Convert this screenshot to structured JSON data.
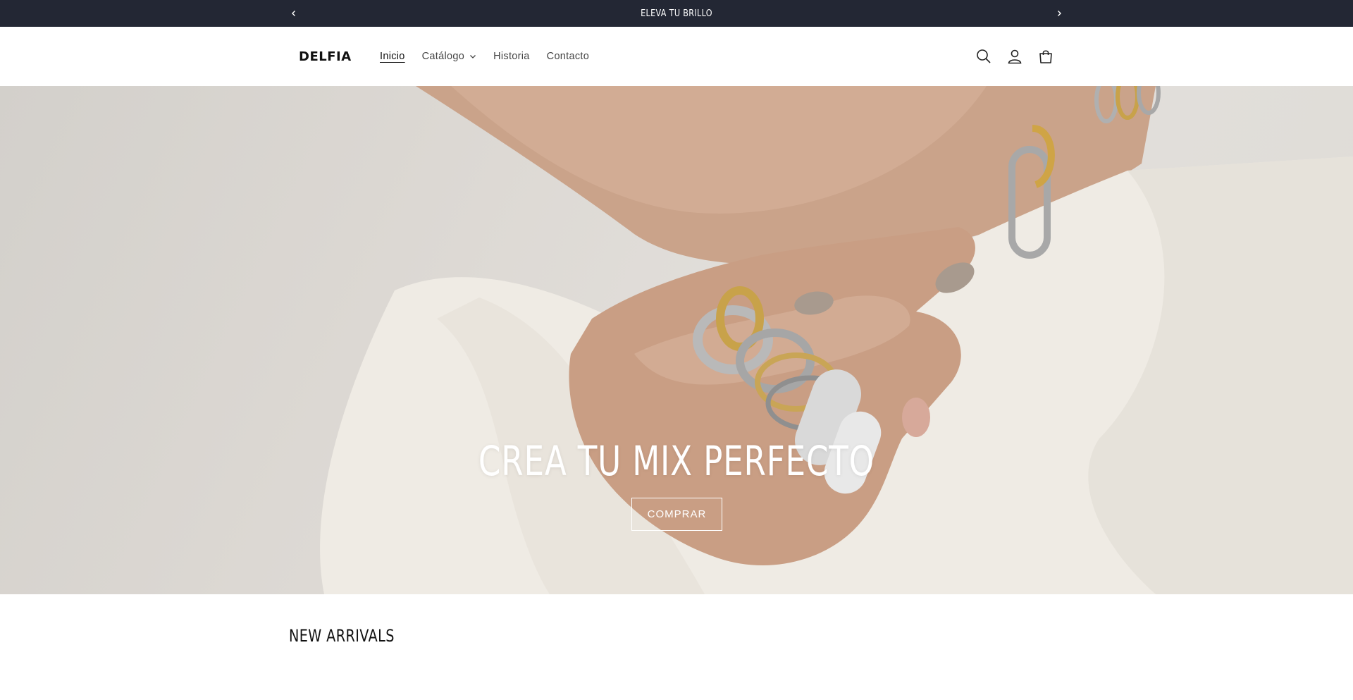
{
  "announcement": {
    "message": "ELEVA TU BRILLO",
    "prev_icon": "chevron-left-icon",
    "next_icon": "chevron-right-icon",
    "background": "#232734"
  },
  "header": {
    "logo": "DELFIA",
    "nav": [
      {
        "label": "Inicio",
        "active": true
      },
      {
        "label": "Catálogo",
        "has_dropdown": true
      },
      {
        "label": "Historia"
      },
      {
        "label": "Contacto"
      }
    ],
    "icons": [
      "search-icon",
      "account-icon",
      "cart-icon"
    ]
  },
  "hero": {
    "title": "CREA TU MIX PERFECTO",
    "button_label": "COMPRAR"
  },
  "new_arrivals": {
    "title": "NEW ARRIVALS"
  }
}
